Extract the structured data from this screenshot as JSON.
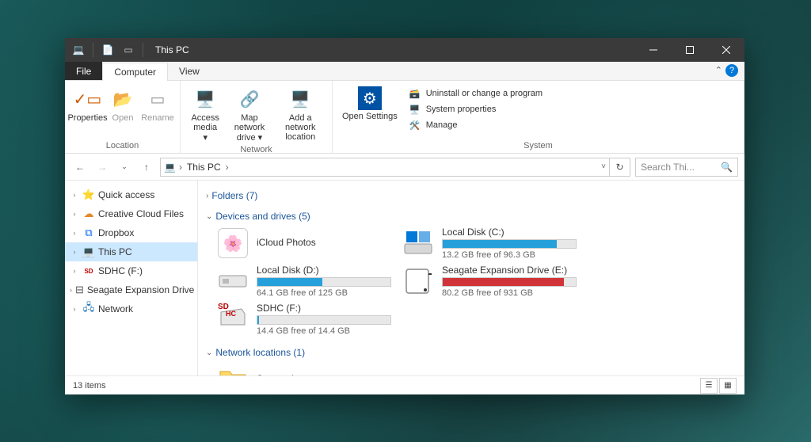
{
  "title": "This PC",
  "tabs": {
    "file": "File",
    "computer": "Computer",
    "view": "View"
  },
  "ribbon": {
    "location": {
      "label": "Location",
      "properties": "Properties",
      "open": "Open",
      "rename": "Rename"
    },
    "network": {
      "label": "Network",
      "access_media": "Access media ▾",
      "map_drive": "Map network drive ▾",
      "add_location": "Add a network location"
    },
    "system": {
      "label": "System",
      "open_settings": "Open Settings",
      "uninstall": "Uninstall or change a program",
      "sysprops": "System properties",
      "manage": "Manage"
    }
  },
  "addr": {
    "crumb": "This PC",
    "dropdown": "˅",
    "refresh": "↻"
  },
  "search": {
    "placeholder": "Search Thi..."
  },
  "sidebar": [
    {
      "label": "Quick access",
      "icon": "⭐",
      "color": "#3aa0e0",
      "exp": true
    },
    {
      "label": "Creative Cloud Files",
      "icon": "☁",
      "color": "#e08a2a",
      "exp": true
    },
    {
      "label": "Dropbox",
      "icon": "⧉",
      "color": "#0061ff",
      "exp": true
    },
    {
      "label": "This PC",
      "icon": "💻",
      "color": "#2a7ab8",
      "exp": true,
      "selected": true
    },
    {
      "label": "SDHC (F:)",
      "icon": "SD",
      "color": "#b00",
      "exp": true,
      "sd": true
    },
    {
      "label": "Seagate Expansion Drive (E:)",
      "icon": "⊟",
      "color": "#555",
      "exp": true
    },
    {
      "label": "Network",
      "icon": "🖧",
      "color": "#2a7ab8",
      "exp": true
    }
  ],
  "sections": {
    "folders": "Folders (7)",
    "drives": "Devices and drives (5)",
    "netloc": "Network locations (1)"
  },
  "drives": [
    {
      "name": "iCloud Photos",
      "icon": "photos",
      "bar": false
    },
    {
      "name": "Local Disk (C:)",
      "icon": "windisk",
      "bar": true,
      "fill": 86,
      "color": "blue",
      "stat": "13.2 GB free of 96.3 GB"
    },
    {
      "name": "Local Disk (D:)",
      "icon": "disk",
      "bar": true,
      "fill": 49,
      "color": "blue",
      "stat": "64.1 GB free of 125 GB"
    },
    {
      "name": "Seagate Expansion Drive (E:)",
      "icon": "extdisk",
      "bar": true,
      "fill": 91,
      "color": "red",
      "stat": "80.2 GB free of 931 GB"
    },
    {
      "name": "SDHC (F:)",
      "icon": "sdcard",
      "bar": true,
      "fill": 1,
      "color": "blue",
      "stat": "14.4 GB free of 14.4 GB"
    }
  ],
  "netfolders": [
    {
      "name": "Screenshots"
    }
  ],
  "status": "13 items"
}
